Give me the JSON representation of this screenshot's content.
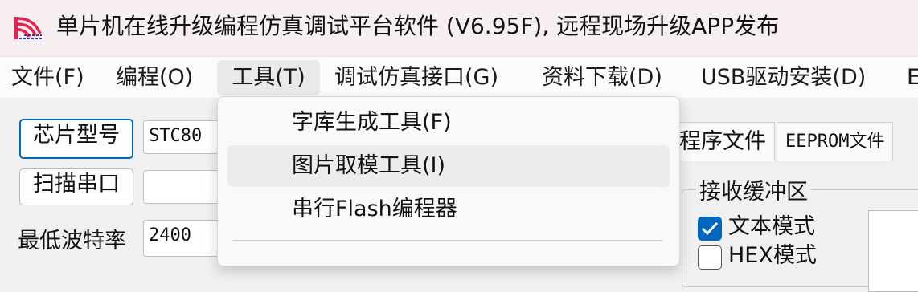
{
  "window": {
    "title": "单片机在线升级编程仿真调试平台软件 (V6.95F), 远程现场升级APP发布",
    "icon": "stc-isp-app-icon"
  },
  "menubar": {
    "items": [
      {
        "label": "文件(F)"
      },
      {
        "label": "编程(O)"
      },
      {
        "label": "工具(T)"
      },
      {
        "label": "调试仿真接口(G)"
      },
      {
        "label": "资料下载(D)"
      },
      {
        "label": "USB驱动安装(D)"
      },
      {
        "label": "E"
      }
    ]
  },
  "left_panel": {
    "chip_model_button": "芯片型号",
    "chip_model_value": "STC80",
    "scan_port_button": "扫描串口",
    "scan_port_value": "",
    "min_baud_label": "最低波特率",
    "min_baud_value": "2400"
  },
  "tabs": {
    "program_file": "程序文件",
    "eeprom_file": "EEPROM文件"
  },
  "receive_buffer": {
    "title": "接收缓冲区",
    "text_mode_label": "文本模式",
    "text_mode_checked": true,
    "hex_mode_label": "HEX模式"
  },
  "tools_menu": {
    "items": [
      {
        "label": "字库生成工具(F)"
      },
      {
        "label": "图片取模工具(I)"
      },
      {
        "label": "串行Flash编程器"
      }
    ]
  },
  "colors": {
    "accent": "#0067c0",
    "titlebar_bg": "#f7eef0",
    "icon_red": "#e8224a",
    "icon_blue": "#1f3fbf"
  }
}
